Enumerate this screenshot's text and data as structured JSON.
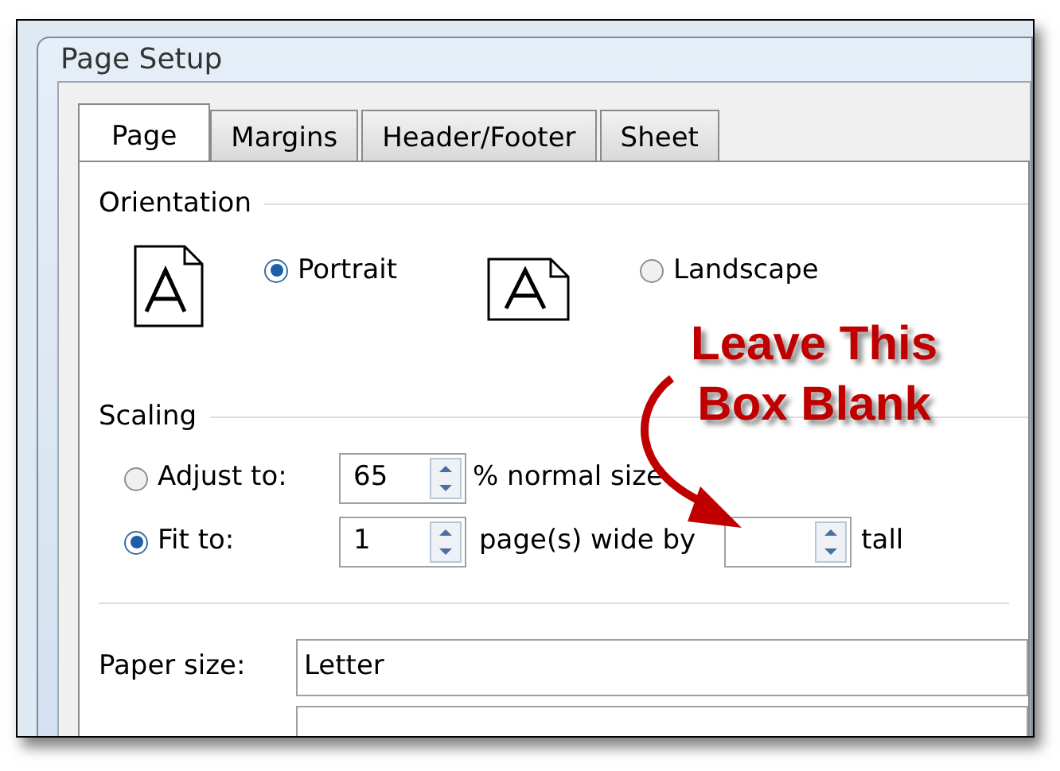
{
  "window": {
    "title": "Page Setup"
  },
  "tabs": [
    {
      "label": "Page",
      "selected": true
    },
    {
      "label": "Margins",
      "selected": false
    },
    {
      "label": "Header/Footer",
      "selected": false
    },
    {
      "label": "Sheet",
      "selected": false
    }
  ],
  "orientation": {
    "heading": "Orientation",
    "options": [
      {
        "label": "Portrait",
        "selected": true,
        "kind": "portrait"
      },
      {
        "label": "Landscape",
        "selected": false,
        "kind": "landscape"
      }
    ]
  },
  "scaling": {
    "heading": "Scaling",
    "options": [
      {
        "kind": "adjust",
        "label": "Adjust to:",
        "selected": false,
        "value": "65",
        "suffix": "% normal size"
      },
      {
        "kind": "fit",
        "label": "Fit to:",
        "selected": true,
        "value": "1",
        "suffix": "page(s) wide by",
        "tall_suffix": "tall"
      }
    ]
  },
  "paper_size": {
    "label": "Paper size:",
    "value": "Letter"
  },
  "annotation": {
    "lines": [
      "Leave This",
      "Box Blank"
    ]
  }
}
